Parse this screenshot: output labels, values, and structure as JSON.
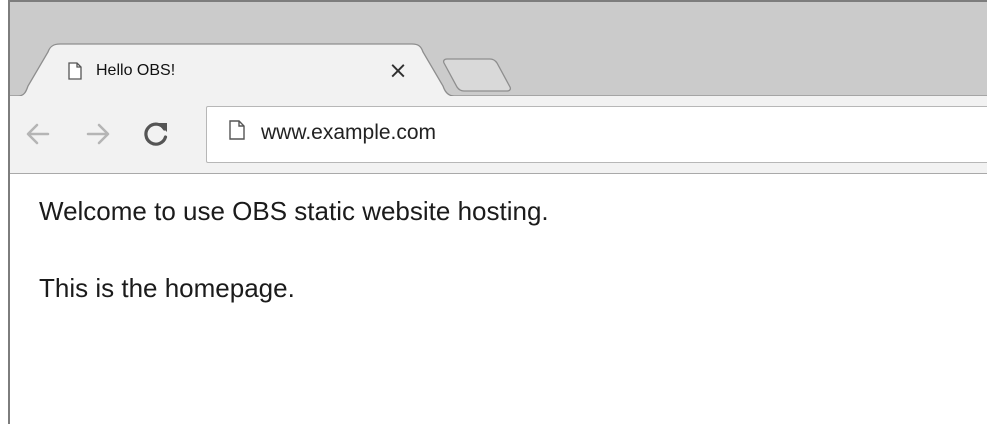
{
  "tabs": [
    {
      "title": "Hello OBS!",
      "close_label": "×",
      "icon": "document-icon",
      "active": true
    }
  ],
  "toolbar": {
    "back_icon": "arrow-left-icon",
    "forward_icon": "arrow-right-icon",
    "reload_icon": "reload-icon",
    "page_icon": "document-icon",
    "url": "www.example.com"
  },
  "page": {
    "paragraphs": [
      "Welcome to use OBS static website hosting.",
      "This is the homepage."
    ]
  },
  "colors": {
    "tabstrip": "#cbcbcb",
    "active_tab": "#f2f2f2",
    "toolbar": "#f2f2f2",
    "content": "#ffffff",
    "disabled_icon": "#b5b5b5"
  }
}
